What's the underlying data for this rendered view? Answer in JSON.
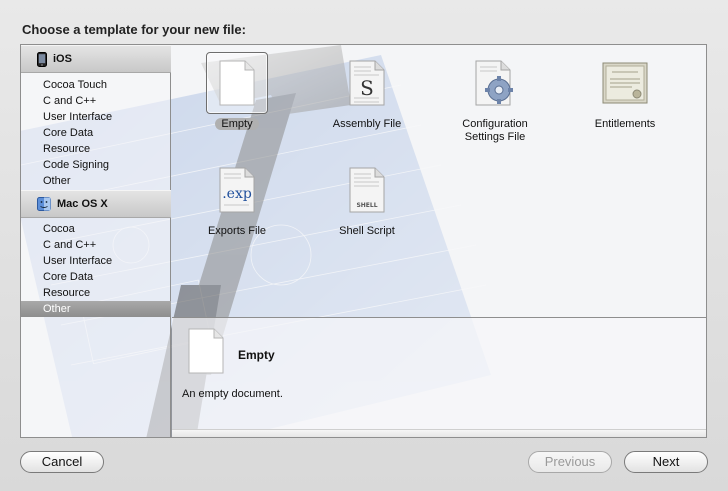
{
  "dialog": {
    "title": "Choose a template for your new file:"
  },
  "sidebar": {
    "groups": [
      {
        "label": "iOS",
        "icon": "iphone-icon",
        "items": [
          "Cocoa Touch",
          "C and C++",
          "User Interface",
          "Core Data",
          "Resource",
          "Code Signing",
          "Other"
        ]
      },
      {
        "label": "Mac OS X",
        "icon": "mac-finder-icon",
        "items": [
          "Cocoa",
          "C and C++",
          "User Interface",
          "Core Data",
          "Resource",
          "Other"
        ],
        "selected_index": 5
      }
    ]
  },
  "templates": [
    {
      "label": "Empty",
      "icon": "blank-document-icon",
      "selected": true
    },
    {
      "label": "Assembly File",
      "icon": "assembly-s-document-icon",
      "badge": "S"
    },
    {
      "label": "Configuration Settings File",
      "label_lines": [
        "Configuration",
        "Settings File"
      ],
      "icon": "config-gear-document-icon"
    },
    {
      "label": "Entitlements",
      "icon": "certificate-icon"
    },
    {
      "label": "Exports File",
      "icon": "exp-document-icon",
      "badge": ".exp"
    },
    {
      "label": "Shell Script",
      "icon": "shell-document-icon",
      "badge": "SHELL"
    }
  ],
  "detail": {
    "title": "Empty",
    "description": "An empty document.",
    "icon": "blank-document-icon"
  },
  "buttons": {
    "cancel": "Cancel",
    "previous": "Previous",
    "next": "Next"
  },
  "colors": {
    "selected_row": "#9b9b9b",
    "blueprint": "#5b7fc0",
    "panel_border": "#8e8e8e"
  }
}
